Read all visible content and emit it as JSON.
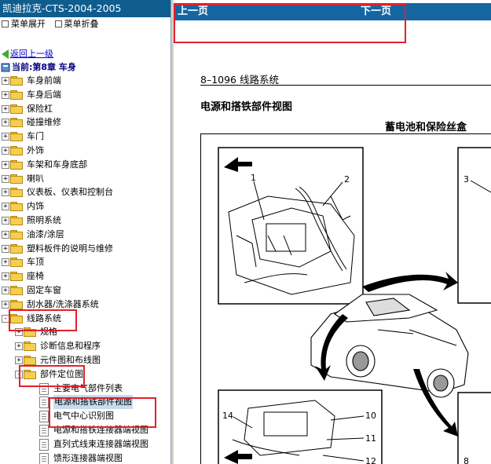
{
  "left_panel": {
    "title": "凯迪拉克-CTS-2004-2005",
    "menu": {
      "expand": "菜单展开",
      "collapse": "菜单折叠"
    },
    "back_link": "返回上一级",
    "current": "当前:第8章 车身",
    "tree": [
      {
        "label": "车身前端",
        "level": 0,
        "expand": "+",
        "selected": false
      },
      {
        "label": "车身后端",
        "level": 0,
        "expand": "+",
        "selected": false
      },
      {
        "label": "保险杠",
        "level": 0,
        "expand": "+",
        "selected": false
      },
      {
        "label": "碰撞维修",
        "level": 0,
        "expand": "+",
        "selected": false
      },
      {
        "label": "车门",
        "level": 0,
        "expand": "+",
        "selected": false
      },
      {
        "label": "外饰",
        "level": 0,
        "expand": "+",
        "selected": false
      },
      {
        "label": "车架和车身底部",
        "level": 0,
        "expand": "+",
        "selected": false
      },
      {
        "label": "喇叭",
        "level": 0,
        "expand": "+",
        "selected": false
      },
      {
        "label": "仪表板、仪表和控制台",
        "level": 0,
        "expand": "+",
        "selected": false
      },
      {
        "label": "内饰",
        "level": 0,
        "expand": "+",
        "selected": false
      },
      {
        "label": "照明系统",
        "level": 0,
        "expand": "+",
        "selected": false
      },
      {
        "label": "油漆/涂层",
        "level": 0,
        "expand": "+",
        "selected": false
      },
      {
        "label": "塑料板件的说明与维修",
        "level": 0,
        "expand": "+",
        "selected": false
      },
      {
        "label": "车顶",
        "level": 0,
        "expand": "+",
        "selected": false
      },
      {
        "label": "座椅",
        "level": 0,
        "expand": "+",
        "selected": false
      },
      {
        "label": "固定车窗",
        "level": 0,
        "expand": "+",
        "selected": false
      },
      {
        "label": "刮水器/洗涤器系统",
        "level": 0,
        "expand": "+",
        "selected": false
      },
      {
        "label": "线路系统",
        "level": 0,
        "expand": "-",
        "selected": false
      },
      {
        "label": "规格",
        "level": 1,
        "expand": "+",
        "selected": false
      },
      {
        "label": "诊断信息和程序",
        "level": 1,
        "expand": "+",
        "selected": false
      },
      {
        "label": "元件图和布线图",
        "level": 1,
        "expand": "+",
        "selected": false
      },
      {
        "label": "部件定位图",
        "level": 1,
        "expand": "-",
        "selected": false
      },
      {
        "label": "主要电气部件列表",
        "level": 2,
        "expand": "",
        "selected": false
      },
      {
        "label": "电源和搭铁部件视图",
        "level": 2,
        "expand": "",
        "selected": true
      },
      {
        "label": "电气中心识别图",
        "level": 2,
        "expand": "",
        "selected": false
      },
      {
        "label": "电源和搭铁连接器端视图",
        "level": 2,
        "expand": "",
        "selected": false
      },
      {
        "label": "直列式线束连接器端视图",
        "level": 2,
        "expand": "",
        "selected": false
      },
      {
        "label": "馈形连接器端视图",
        "level": 2,
        "expand": "",
        "selected": false
      }
    ]
  },
  "nav": {
    "prev": "上一页",
    "next": "下一页"
  },
  "document": {
    "page_header": "8–1096    线路系统",
    "section_title": "电源和搭铁部件视图",
    "figure_title": "蓄电池和保险丝盒",
    "callouts": [
      "1",
      "2",
      "3",
      "14",
      "10",
      "11",
      "12",
      "8"
    ]
  },
  "colors": {
    "title_bar": "#0f5d8f",
    "nav_bar": "#1466a1",
    "highlight": "#e3202a",
    "selection": "#c7dcf0"
  }
}
